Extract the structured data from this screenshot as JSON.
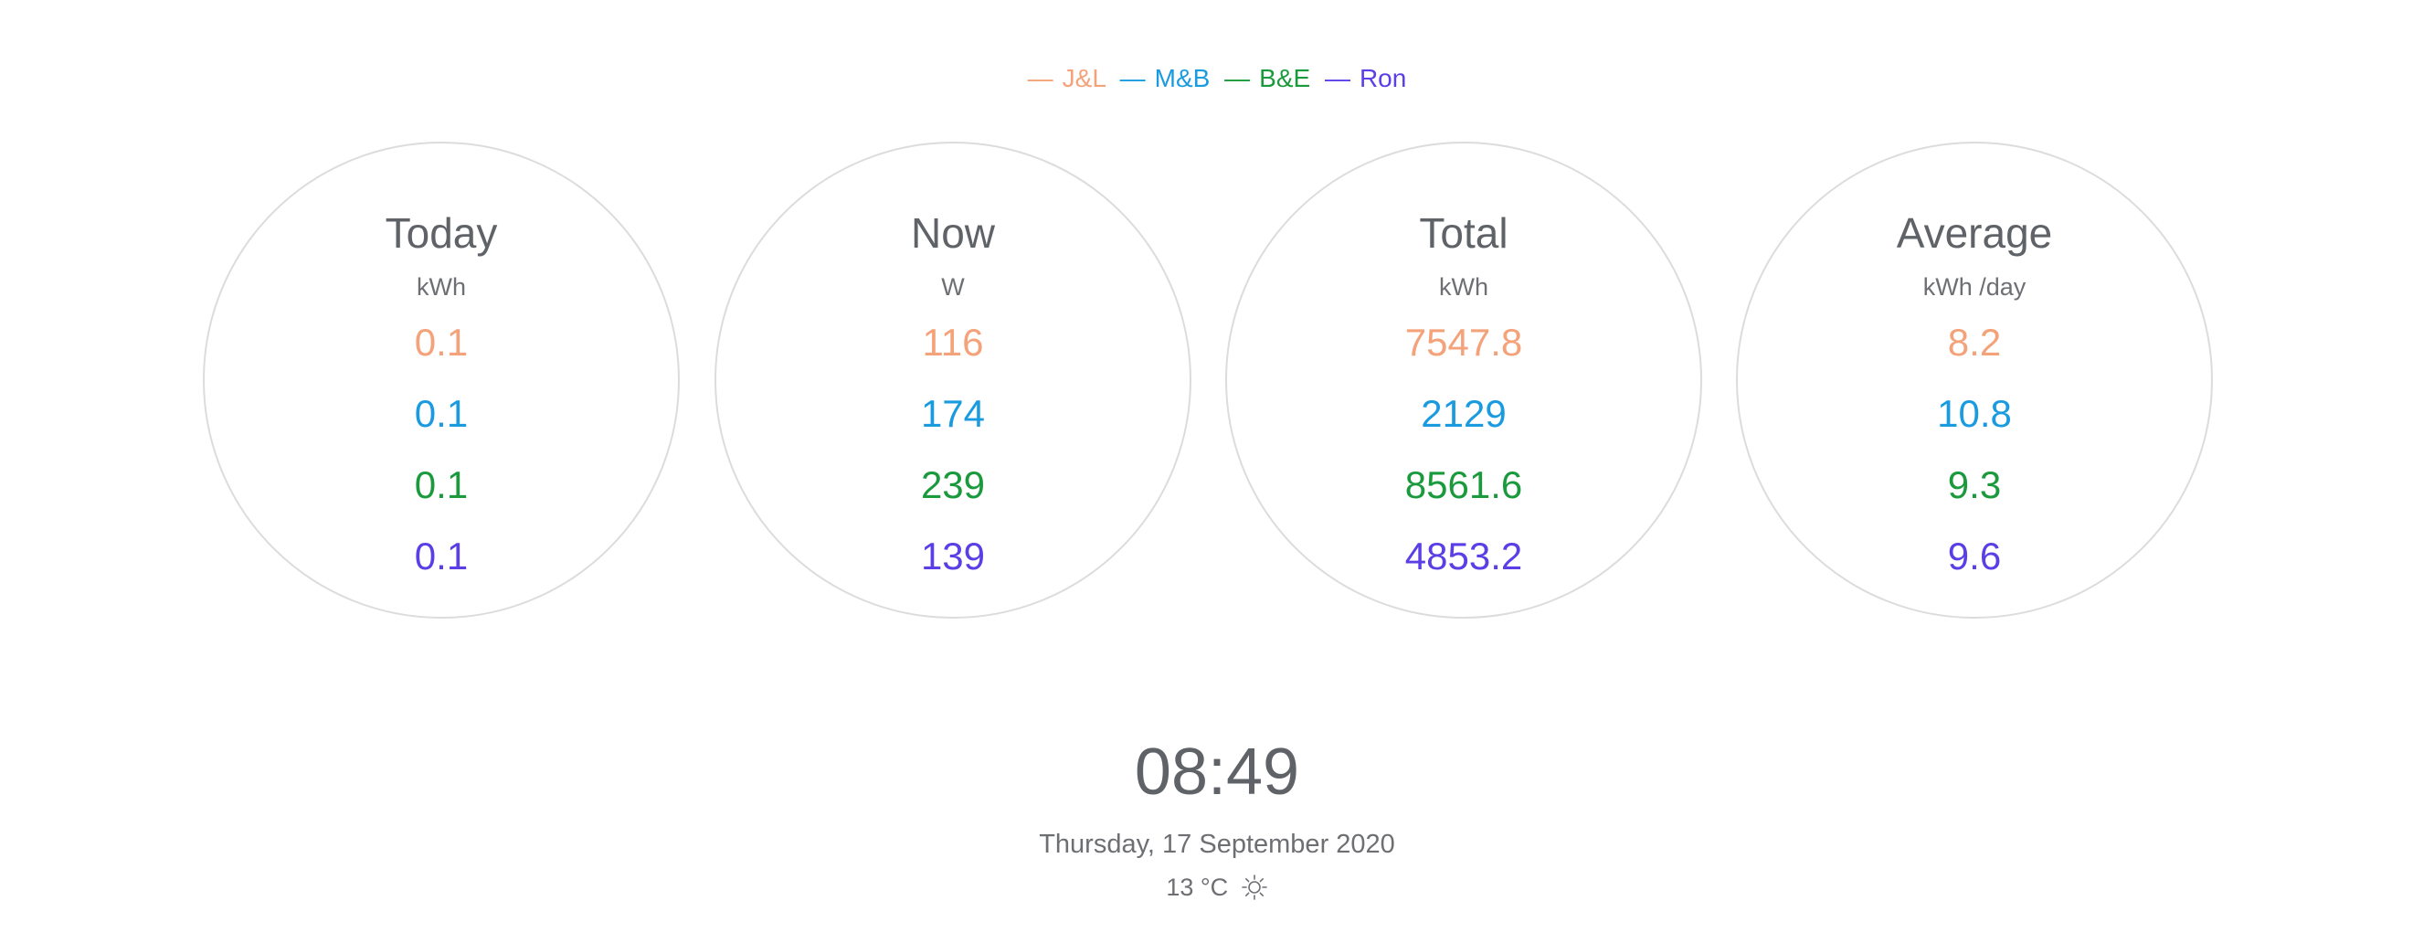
{
  "legend": {
    "items": [
      {
        "dash": "—",
        "label": "J&L",
        "color": "#f4a27a"
      },
      {
        "dash": "—",
        "label": "M&B",
        "color": "#1a9be0"
      },
      {
        "dash": "—",
        "label": "B&E",
        "color": "#1a9a3c"
      },
      {
        "dash": "—",
        "label": "Ron",
        "color": "#5b3ee6"
      }
    ]
  },
  "panels": [
    {
      "title": "Today",
      "unit": "kWh",
      "values": [
        "0.1",
        "0.1",
        "0.1",
        "0.1"
      ]
    },
    {
      "title": "Now",
      "unit": "W",
      "values": [
        "116",
        "174",
        "239",
        "139"
      ]
    },
    {
      "title": "Total",
      "unit": "kWh",
      "values": [
        "7547.8",
        "2129",
        "8561.6",
        "4853.2"
      ]
    },
    {
      "title": "Average",
      "unit": "kWh /day",
      "values": [
        "8.2",
        "10.8",
        "9.3",
        "9.6"
      ]
    }
  ],
  "clock": {
    "time": "08:49",
    "date": "Thursday, 17 September 2020",
    "temperature": "13 °C",
    "weather_icon": "sun-icon"
  }
}
